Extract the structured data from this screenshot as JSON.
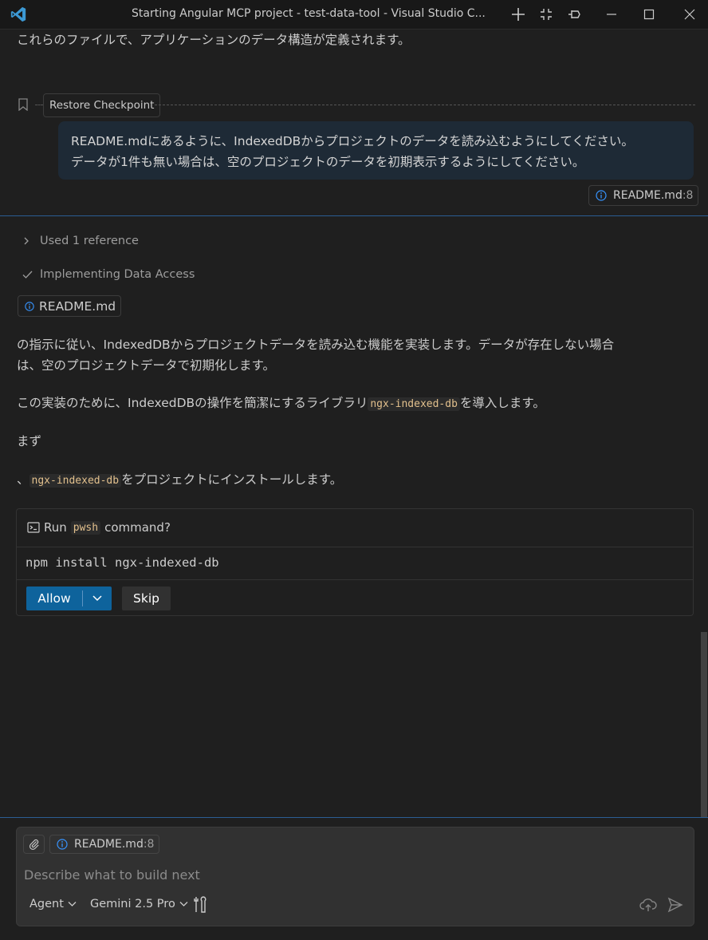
{
  "window": {
    "title": "Starting Angular MCP project - test-data-tool - Visual Studio C..."
  },
  "chat": {
    "previous_text": "これらのファイルで、アプリケーションのデータ構造が定義されます。",
    "restore_checkpoint_label": "Restore Checkpoint",
    "user_message_line1": "README.mdにあるように、IndexedDBからプロジェクトのデータを読み込むようにしてください。",
    "user_message_line2": "データが1件も無い場合は、空のプロジェクトのデータを初期表示するようにしてください。",
    "user_ref": {
      "file": "README.md",
      "line": ":8"
    },
    "steps": {
      "references": "Used 1 reference",
      "implementing": "Implementing Data Access"
    },
    "file_ref": "README.md",
    "para1_line1": "の指示に従い、IndexedDBからプロジェクトデータを読み込む機能を実装します。データが存在しない場合",
    "para1_line2": "は、空のプロジェクトデータで初期化します。",
    "para2_pre": "この実装のために、IndexedDBの操作を簡潔にするライブラリ",
    "para2_code": "ngx-indexed-db",
    "para2_post": "を導入します。",
    "para3": "まず",
    "para4_pre": "、",
    "para4_code": "ngx-indexed-db",
    "para4_post": "をプロジェクトにインストールします。"
  },
  "tool_confirm": {
    "run_label": "Run",
    "shell": "pwsh",
    "command_label": "command?",
    "command": "npm install ngx-indexed-db",
    "allow_label": "Allow",
    "skip_label": "Skip"
  },
  "input": {
    "context_file": "README.md",
    "context_line": ":8",
    "placeholder": "Describe what to build next",
    "mode": "Agent",
    "model": "Gemini 2.5 Pro"
  },
  "colors": {
    "accent": "#0e639c",
    "divider": "#2b5d93",
    "info_icon": "#3794ff",
    "inline_code": "#e2c08d"
  }
}
